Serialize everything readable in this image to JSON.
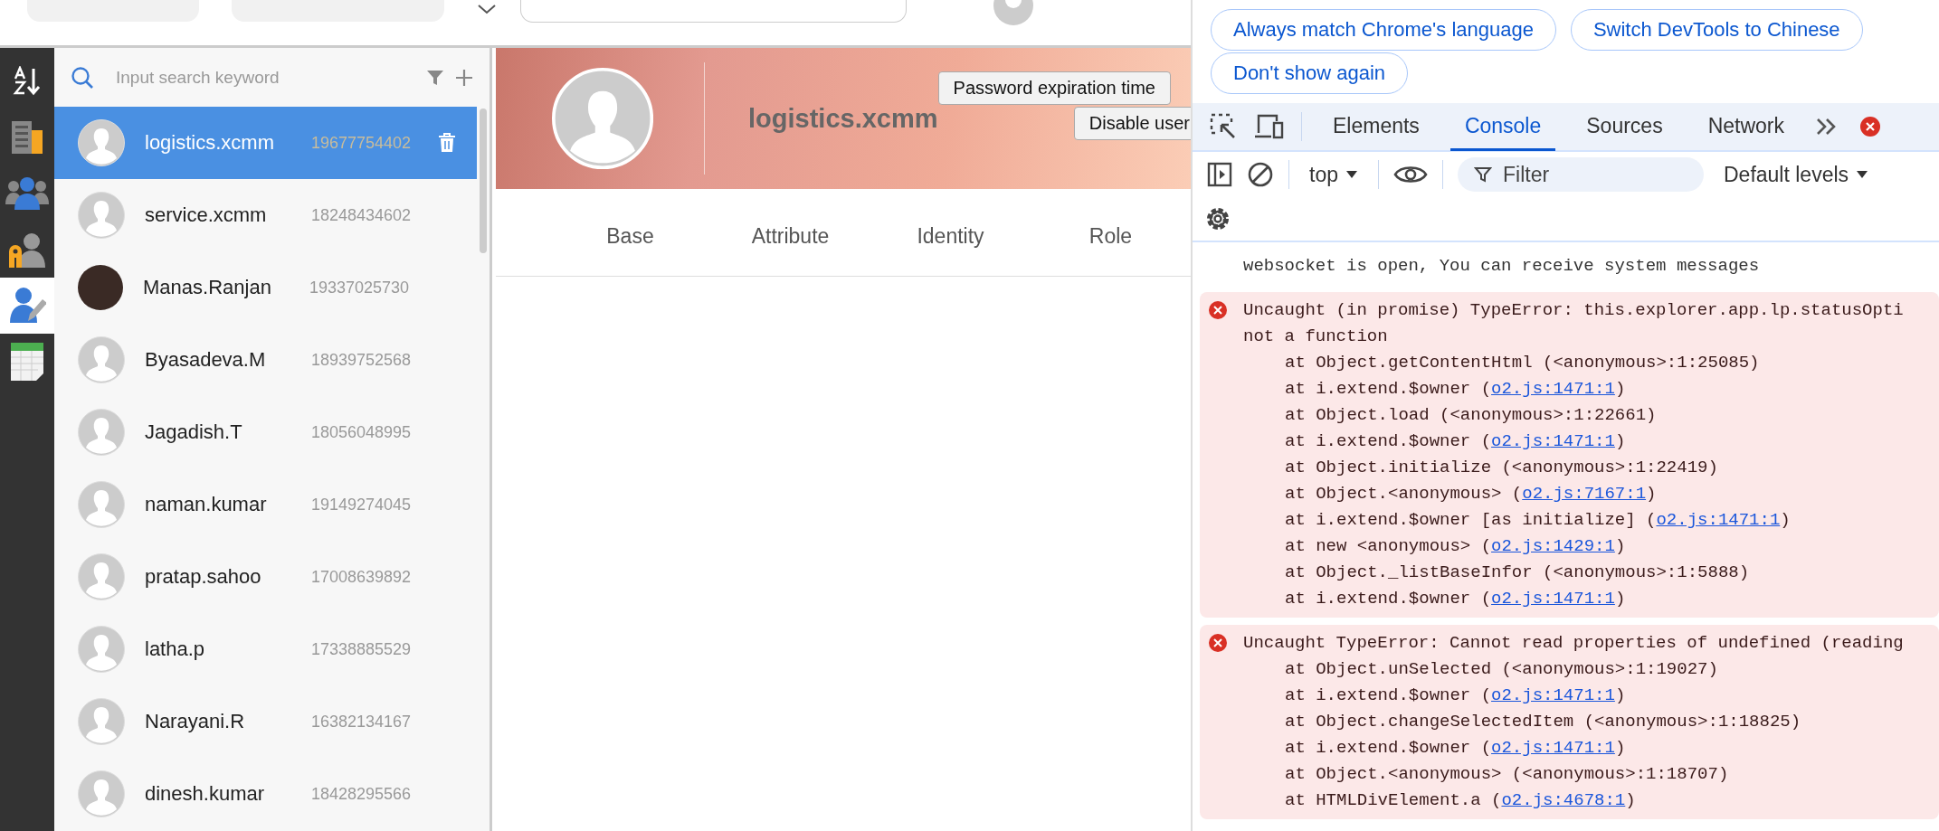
{
  "sidebar": {
    "items": [
      {
        "kind": "sort",
        "selected": false
      },
      {
        "kind": "building",
        "selected": false
      },
      {
        "kind": "group",
        "selected": false
      },
      {
        "kind": "user-tag",
        "selected": false
      },
      {
        "kind": "user-edit",
        "selected": true
      },
      {
        "kind": "sheet",
        "selected": false
      }
    ]
  },
  "user_list": {
    "search": {
      "placeholder": "Input search keyword"
    },
    "users": [
      {
        "name": "logistics.xcmm",
        "phone": "19677754402",
        "photo": false,
        "selected": true
      },
      {
        "name": "service.xcmm",
        "phone": "18248434602",
        "photo": false,
        "selected": false
      },
      {
        "name": "Manas.Ranjan",
        "phone": "19337025730",
        "photo": true,
        "selected": false
      },
      {
        "name": "Byasadeva.M",
        "phone": "18939752568",
        "photo": false,
        "selected": false
      },
      {
        "name": "Jagadish.T",
        "phone": "18056048995",
        "photo": false,
        "selected": false
      },
      {
        "name": "naman.kumar",
        "phone": "19149274045",
        "photo": false,
        "selected": false
      },
      {
        "name": "pratap.sahoo",
        "phone": "17008639892",
        "photo": false,
        "selected": false
      },
      {
        "name": "latha.p",
        "phone": "17338885529",
        "photo": false,
        "selected": false
      },
      {
        "name": "Narayani.R",
        "phone": "16382134167",
        "photo": false,
        "selected": false
      },
      {
        "name": "dinesh.kumar",
        "phone": "18428295566",
        "photo": false,
        "selected": false
      }
    ]
  },
  "profile": {
    "name": "logistics.xcmm",
    "buttons": [
      "Password expiration time",
      "Disable user"
    ],
    "tabs": [
      "Base",
      "Attribute",
      "Identity",
      "Role"
    ]
  },
  "devtools": {
    "banner_buttons": [
      "Always match Chrome's language",
      "Switch DevTools to Chinese",
      "Don't show again"
    ],
    "tabs": [
      {
        "label": "Elements",
        "selected": false
      },
      {
        "label": "Console",
        "selected": true
      },
      {
        "label": "Sources",
        "selected": false
      },
      {
        "label": "Network",
        "selected": false
      }
    ],
    "context": "top",
    "filter_placeholder": "Filter",
    "levels": "Default levels",
    "messages": [
      {
        "kind": "log",
        "lines": [
          "websocket is open, You can receive system messages"
        ]
      },
      {
        "kind": "error",
        "lines": [
          "Uncaught (in promise) TypeError: this.explorer.app.lp.statusOpti",
          "not a function"
        ],
        "stack": [
          {
            "text": "at Object.getContentHtml (<anonymous>:1:25085)"
          },
          {
            "text": "at i.extend.$owner (",
            "link": "o2.js:1471:1",
            "suffix": ")"
          },
          {
            "text": "at Object.load (<anonymous>:1:22661)"
          },
          {
            "text": "at i.extend.$owner (",
            "link": "o2.js:1471:1",
            "suffix": ")"
          },
          {
            "text": "at Object.initialize (<anonymous>:1:22419)"
          },
          {
            "text": "at Object.<anonymous> (",
            "link": "o2.js:7167:1",
            "suffix": ")"
          },
          {
            "text": "at i.extend.$owner [as initialize] (",
            "link": "o2.js:1471:1",
            "suffix": ")"
          },
          {
            "text": "at new <anonymous> (",
            "link": "o2.js:1429:1",
            "suffix": ")"
          },
          {
            "text": "at Object._listBaseInfor (<anonymous>:1:5888)"
          },
          {
            "text": "at i.extend.$owner (",
            "link": "o2.js:1471:1",
            "suffix": ")"
          }
        ]
      },
      {
        "kind": "error",
        "lines": [
          "Uncaught TypeError: Cannot read properties of undefined (reading"
        ],
        "stack": [
          {
            "text": "at Object.unSelected (<anonymous>:1:19027)"
          },
          {
            "text": "at i.extend.$owner (",
            "link": "o2.js:1471:1",
            "suffix": ")"
          },
          {
            "text": "at Object.changeSelectedItem (<anonymous>:1:18825)"
          },
          {
            "text": "at i.extend.$owner (",
            "link": "o2.js:1471:1",
            "suffix": ")"
          },
          {
            "text": "at Object.<anonymous> (<anonymous>:1:18707)"
          },
          {
            "text": "at HTMLDivElement.a (",
            "link": "o2.js:4678:1",
            "suffix": ")"
          }
        ]
      }
    ]
  }
}
